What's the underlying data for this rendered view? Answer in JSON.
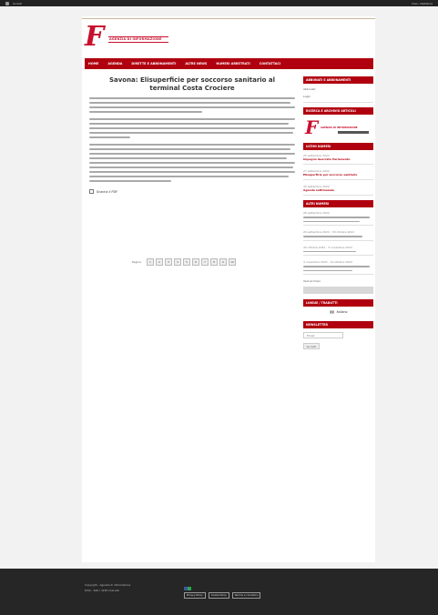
{
  "adminbar": {
    "left": "Accedi",
    "right": "Ciao, Visitatore"
  },
  "site": {
    "logo_letter": "F",
    "logo_name": "AGENZIA DI INFORMAZIONE"
  },
  "nav": [
    "HOME",
    "AGENDA",
    "DIRETTE E ABBONAMENTI",
    "ALTRE NEWS",
    "NUMERI ARRETRATI",
    "CONTATTACI"
  ],
  "article": {
    "title": "Savona: Elisuperficie per soccorso sanitario al terminal Costa Crociere",
    "pdf_label": "Scarica il PDF"
  },
  "pager": {
    "label": "Pagina",
    "pages": [
      "1",
      "2",
      "3",
      "4",
      "5",
      "6",
      "7",
      "8",
      "9",
      "10"
    ]
  },
  "sidebar": {
    "w1_title": "ABBONATI E ABBONAMENTI",
    "w1_links": [
      "Abbonati",
      "Login"
    ],
    "w2_title": "RICERCA E ARCHIVIO ARTICOLI",
    "w3_title": "ULTIMI NUMERI",
    "w3_items": [
      {
        "date": "25 settembre 2022",
        "title": "Impegno Guerrato Parlamento"
      },
      {
        "date": "27 settembre 2022",
        "title": "Elisuperficie per soccorso sanitario"
      },
      {
        "date": "30 settembre 2022",
        "title": "Agenda settimanale"
      }
    ],
    "w4_title": "ALTRI NUMERI",
    "w4_items": [
      {
        "date": "28 settembre 2022"
      },
      {
        "date": "29 settembre 2022 - 30 ottobre 2022"
      },
      {
        "date": "30 ottobre 2022 - 3 novembre 2022"
      },
      {
        "date": "4 novembre 2022 - 10 ottobre 2022"
      }
    ],
    "w4_more": "Vedi archivio",
    "w5_title": "LINGUE / TRADUTTI",
    "w5_flag": "Italiano",
    "w6_title": "NEWSLETTER",
    "w6_input": "Email",
    "w6_button": "Iscriviti"
  },
  "footer": {
    "line1": "Copyright - Agenzia di informazione",
    "line2": "P.IVA - Tutti i diritti riservati",
    "buttons": [
      "Privacy Policy",
      "Cookie Policy",
      "Termini e condizioni"
    ]
  }
}
